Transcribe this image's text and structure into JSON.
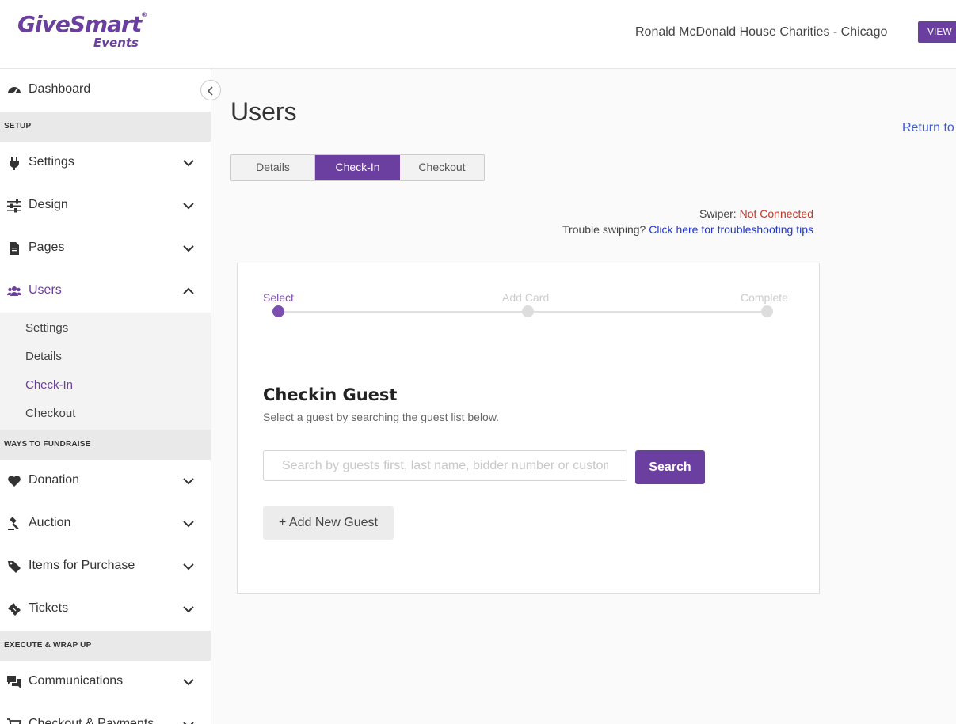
{
  "brand": {
    "logo_main": "GiveSmart",
    "logo_reg": "®",
    "logo_sub": "Events",
    "accent": "#6b3fa0"
  },
  "header": {
    "org_name": "Ronald McDonald House Charities - Chicago",
    "view_label": "VIEW"
  },
  "sidebar": {
    "dashboard": {
      "label": "Dashboard",
      "icon": "dashboard-icon"
    },
    "sections": [
      {
        "heading": "SETUP"
      },
      {
        "heading": "WAYS TO FUNDRAISE"
      },
      {
        "heading": "EXECUTE & WRAP UP"
      }
    ],
    "settings": {
      "label": "Settings",
      "icon": "plug-icon"
    },
    "design": {
      "label": "Design",
      "icon": "sliders-icon"
    },
    "pages": {
      "label": "Pages",
      "icon": "page-icon"
    },
    "users": {
      "label": "Users",
      "icon": "users-icon",
      "sub": [
        "Settings",
        "Details",
        "Check-In",
        "Checkout"
      ],
      "active_sub": "Check-In"
    },
    "donation": {
      "label": "Donation",
      "icon": "heart-icon"
    },
    "auction": {
      "label": "Auction",
      "icon": "gavel-icon"
    },
    "items_for_purchase": {
      "label": "Items for Purchase",
      "icon": "tag-icon"
    },
    "tickets": {
      "label": "Tickets",
      "icon": "ticket-icon"
    },
    "communications": {
      "label": "Communications",
      "icon": "chat-icon"
    },
    "checkout_payments": {
      "label": "Checkout & Payments",
      "icon": "cart-icon"
    }
  },
  "main": {
    "title": "Users",
    "return_link": "Return to",
    "tabs": [
      "Details",
      "Check-In",
      "Checkout"
    ],
    "active_tab": "Check-In",
    "swiper_label": "Swiper:",
    "swiper_status": "Not Connected",
    "trouble_text": "Trouble swiping?",
    "trouble_link": "Click here for troubleshooting tips",
    "steps": [
      "Select",
      "Add Card",
      "Complete"
    ],
    "current_step": "Select",
    "card_title": "Checkin Guest",
    "card_subtitle": "Select a guest by searching the guest list below.",
    "search_placeholder": "Search by guests first, last name, bidder number or custom field",
    "search_value": "",
    "search_button": "Search",
    "add_guest_button": "+ Add New Guest"
  }
}
